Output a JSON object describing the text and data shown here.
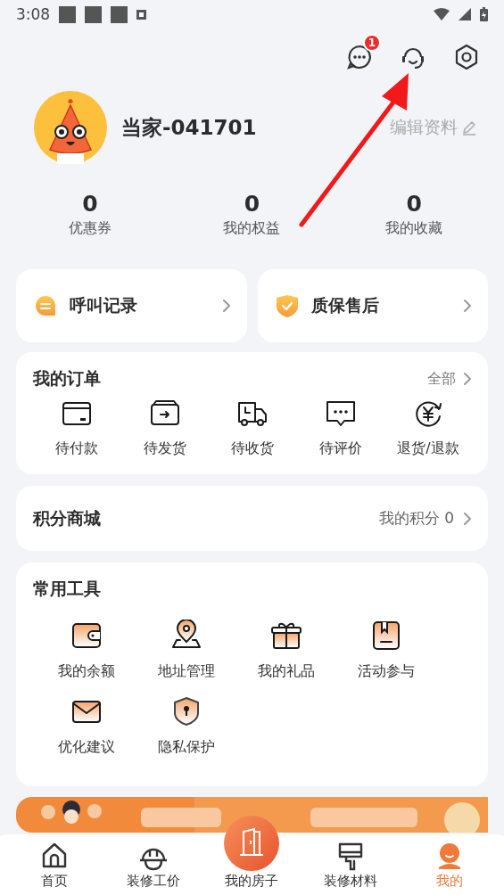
{
  "status_bar": {
    "time": "3:08"
  },
  "header": {
    "messages_badge": "1"
  },
  "profile": {
    "name": "当家-041701",
    "edit_label": "编辑资料"
  },
  "stats": [
    {
      "value": "0",
      "label": "优惠券"
    },
    {
      "value": "0",
      "label": "我的权益"
    },
    {
      "value": "0",
      "label": "我的收藏"
    }
  ],
  "quick_cards": [
    {
      "label": "呼叫记录"
    },
    {
      "label": "质保售后"
    }
  ],
  "orders": {
    "title": "我的订单",
    "more": "全部",
    "items": [
      {
        "label": "待付款"
      },
      {
        "label": "待发货"
      },
      {
        "label": "待收货"
      },
      {
        "label": "待评价"
      },
      {
        "label": "退货/退款"
      }
    ]
  },
  "points": {
    "title": "积分商城",
    "value": "我的积分 0"
  },
  "tools": {
    "title": "常用工具",
    "items": [
      {
        "label": "我的余额"
      },
      {
        "label": "地址管理"
      },
      {
        "label": "我的礼品"
      },
      {
        "label": "活动参与"
      },
      {
        "label": "优化建议"
      },
      {
        "label": "隐私保护"
      }
    ]
  },
  "tab_bar": [
    {
      "label": "首页",
      "selected": false
    },
    {
      "label": "装修工价",
      "selected": false
    },
    {
      "label": "我的房子",
      "selected": false
    },
    {
      "label": "装修材料",
      "selected": false
    },
    {
      "label": "我的",
      "selected": true
    }
  ]
}
